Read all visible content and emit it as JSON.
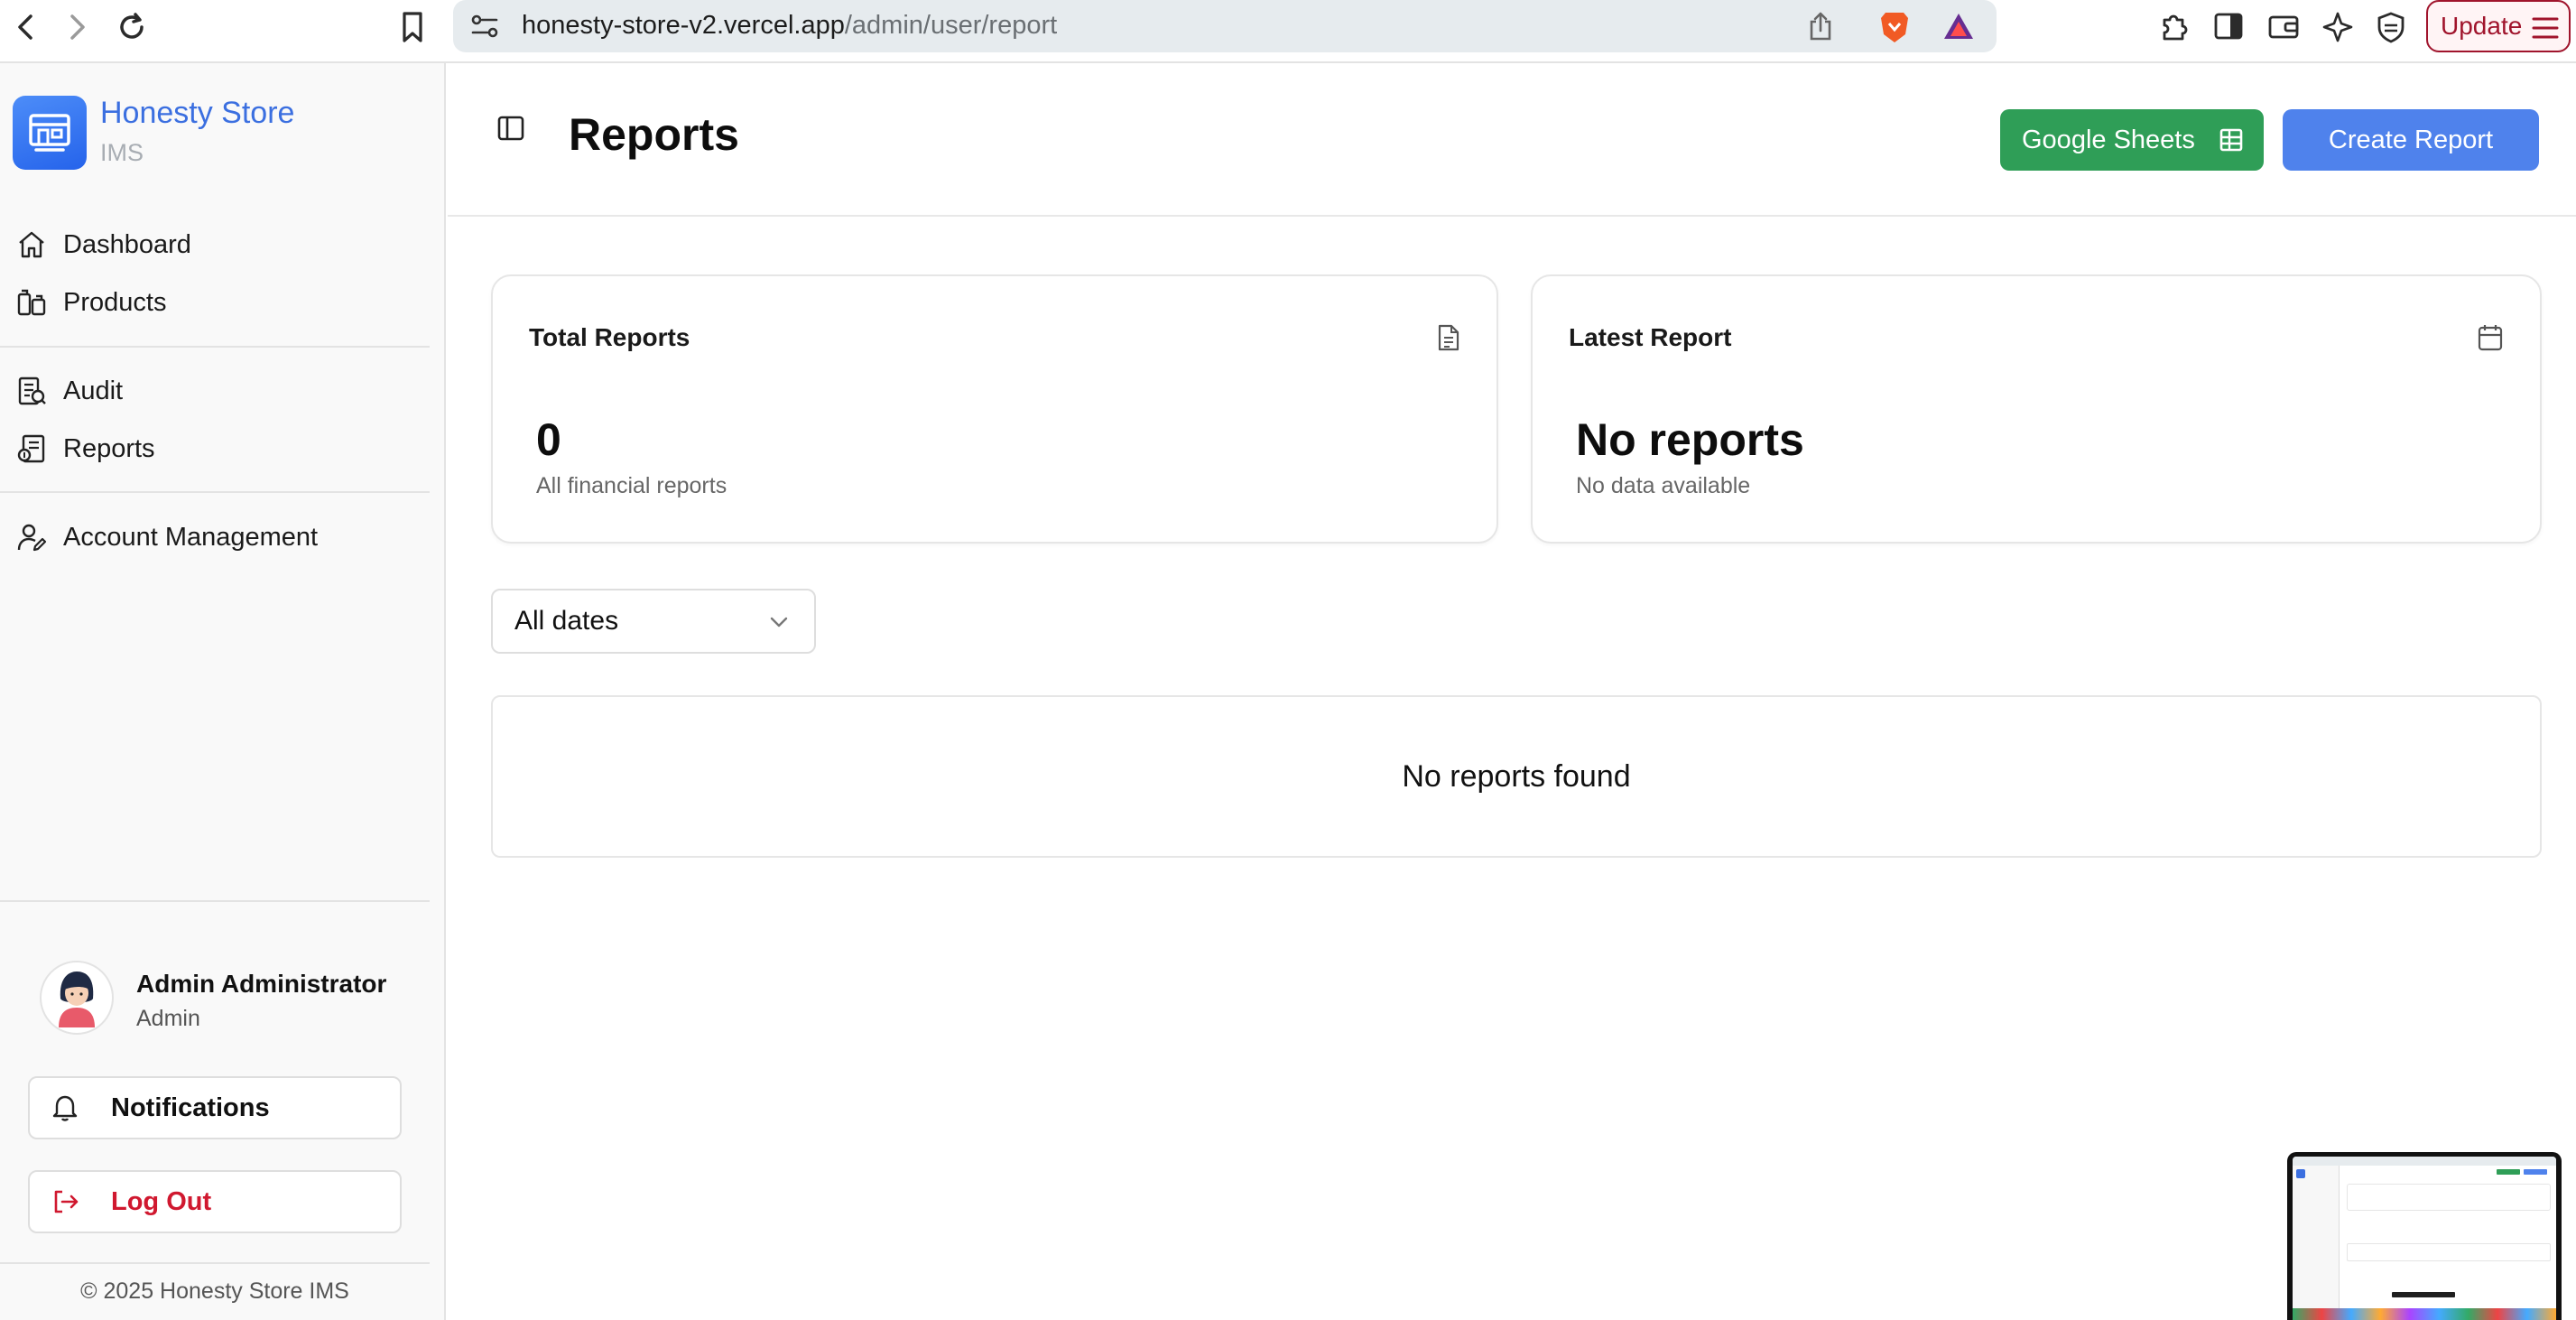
{
  "browser": {
    "url_host": "honesty-store-v2.vercel.app",
    "url_path": "/admin/user/report",
    "update_label": "Update"
  },
  "sidebar": {
    "brand_name": "Honesty Store",
    "brand_sub": "IMS",
    "items": [
      {
        "label": "Dashboard",
        "icon": "home-icon"
      },
      {
        "label": "Products",
        "icon": "products-icon"
      },
      {
        "label": "Audit",
        "icon": "audit-icon"
      },
      {
        "label": "Reports",
        "icon": "reports-icon"
      },
      {
        "label": "Account Management",
        "icon": "user-edit-icon"
      }
    ],
    "user": {
      "name": "Admin Administrator",
      "role": "Admin"
    },
    "notifications_label": "Notifications",
    "logout_label": "Log Out",
    "copyright": "© 2025 Honesty Store IMS",
    "logout_color": "#d0182f"
  },
  "header": {
    "title": "Reports",
    "sheets_label": "Google Sheets",
    "create_label": "Create Report",
    "sheets_color": "#2f9e57",
    "create_color": "#4f82ec"
  },
  "cards": {
    "total": {
      "title": "Total Reports",
      "value": "0",
      "sub": "All financial reports",
      "icon": "file-text-icon"
    },
    "latest": {
      "title": "Latest Report",
      "value": "No reports",
      "sub": "No data available",
      "icon": "calendar-icon"
    }
  },
  "filter": {
    "selected": "All dates"
  },
  "empty_message": "No reports found"
}
